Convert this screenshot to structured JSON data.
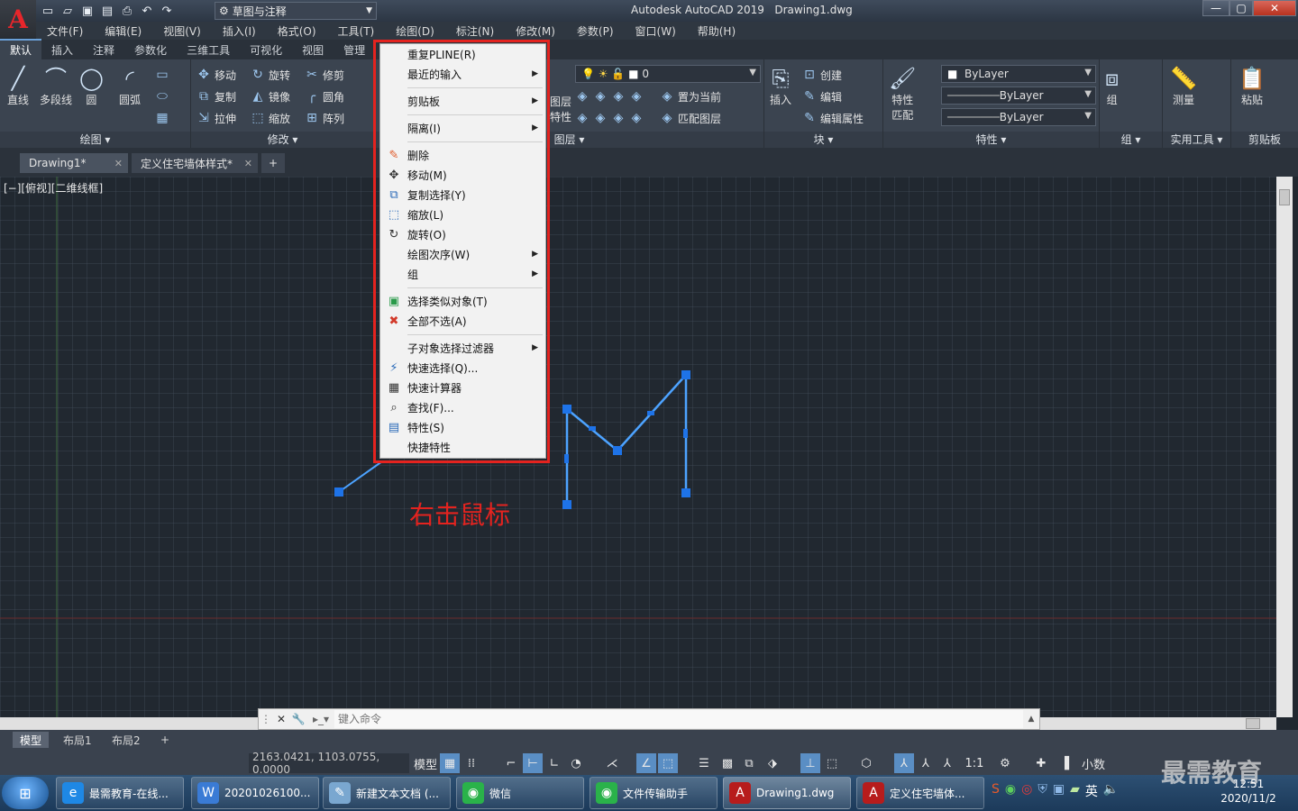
{
  "app": {
    "logo_letter": "A",
    "workspace": "草图与注释",
    "title_app": "Autodesk AutoCAD 2019",
    "title_doc": "Drawing1.dwg",
    "window_buttons": [
      "—",
      "▢",
      "✕"
    ]
  },
  "menubar": [
    "文件(F)",
    "编辑(E)",
    "视图(V)",
    "插入(I)",
    "格式(O)",
    "工具(T)",
    "绘图(D)",
    "标注(N)",
    "修改(M)",
    "参数(P)",
    "窗口(W)",
    "帮助(H)"
  ],
  "ribbon_tabs": [
    "默认",
    "插入",
    "注释",
    "参数化",
    "三维工具",
    "可视化",
    "视图",
    "管理"
  ],
  "ribbon": {
    "draw": {
      "title": "绘图 ▾",
      "line": "直线",
      "pline": "多段线",
      "circle": "圆",
      "arc": "圆弧"
    },
    "modify": {
      "title": "修改 ▾",
      "move": "移动",
      "rotate": "旋转",
      "trim": "修剪",
      "copy": "复制",
      "mirror": "镜像",
      "fillet": "圆角",
      "stretch": "拉伸",
      "scale": "缩放",
      "array": "阵列"
    },
    "layers": {
      "title": "图层 ▾",
      "layer_label": "图层",
      "layer_label2": "特性",
      "current_layer": "0",
      "set_current": "置为当前",
      "match_layer": "匹配图层"
    },
    "block": {
      "title": "块 ▾",
      "insert": "插入",
      "create": "创建",
      "edit": "编辑",
      "edit_attr": "编辑属性"
    },
    "properties": {
      "title": "特性 ▾",
      "match": "特性",
      "match2": "匹配",
      "color": "ByLayer",
      "linetype": "ByLayer",
      "lineweight": "ByLayer"
    },
    "groups": {
      "title": "组 ▾",
      "group": "组"
    },
    "utilities": {
      "title": "实用工具 ▾",
      "measure": "测量"
    },
    "clipboard": {
      "title": "剪贴板",
      "paste": "粘贴"
    }
  },
  "doc_tabs": [
    {
      "label": "Drawing1*"
    },
    {
      "label": "定义住宅墙体样式*"
    }
  ],
  "doc_tab_add": "+",
  "viewport_label": "[−][俯视][二维线框]",
  "context_menu": {
    "items": [
      {
        "label": "重复PLINE(R)",
        "icon": "",
        "sub": false
      },
      {
        "label": "最近的输入",
        "icon": "",
        "sub": true
      },
      {
        "label": "剪贴板",
        "icon": "",
        "sub": true
      },
      {
        "label": "隔离(I)",
        "icon": "",
        "sub": true
      },
      {
        "label": "删除",
        "icon": "eraser-icon",
        "sub": false
      },
      {
        "label": "移动(M)",
        "icon": "move-icon",
        "sub": false
      },
      {
        "label": "复制选择(Y)",
        "icon": "copy-icon",
        "sub": false
      },
      {
        "label": "缩放(L)",
        "icon": "scale-icon",
        "sub": false
      },
      {
        "label": "旋转(O)",
        "icon": "rotate-icon",
        "sub": false
      },
      {
        "label": "绘图次序(W)",
        "icon": "",
        "sub": true
      },
      {
        "label": "组",
        "icon": "",
        "sub": true
      },
      {
        "label": "选择类似对象(T)",
        "icon": "select-similar-icon",
        "sub": false
      },
      {
        "label": "全部不选(A)",
        "icon": "deselect-icon",
        "sub": false
      },
      {
        "label": "子对象选择过滤器",
        "icon": "",
        "sub": true
      },
      {
        "label": "快速选择(Q)...",
        "icon": "quick-select-icon",
        "sub": false
      },
      {
        "label": "快速计算器",
        "icon": "calculator-icon",
        "sub": false
      },
      {
        "label": "查找(F)...",
        "icon": "find-icon",
        "sub": false
      },
      {
        "label": "特性(S)",
        "icon": "properties-icon",
        "sub": false
      },
      {
        "label": "快捷特性",
        "icon": "",
        "sub": false
      }
    ]
  },
  "annotation": "右击鼠标",
  "command_line": {
    "placeholder": "键入命令"
  },
  "layout_tabs": [
    "模型",
    "布局1",
    "布局2"
  ],
  "status": {
    "coords": "2163.0421, 1103.0755, 0.0000",
    "model": "模型",
    "scale": "1:1",
    "units": "小数"
  },
  "taskbar": {
    "tasks": [
      "最需教育-在线...",
      "20201026100...",
      "新建文本文档 (...",
      "微信",
      "文件传输助手",
      "Drawing1.dwg",
      "定义住宅墙体..."
    ],
    "time": "12:51",
    "date": "2020/11/2",
    "ime": "英"
  },
  "watermark": "最需教育",
  "colors": {
    "highlight": "#e4231f",
    "grip": "#1e73e8",
    "polyline": "#4da3ff"
  }
}
